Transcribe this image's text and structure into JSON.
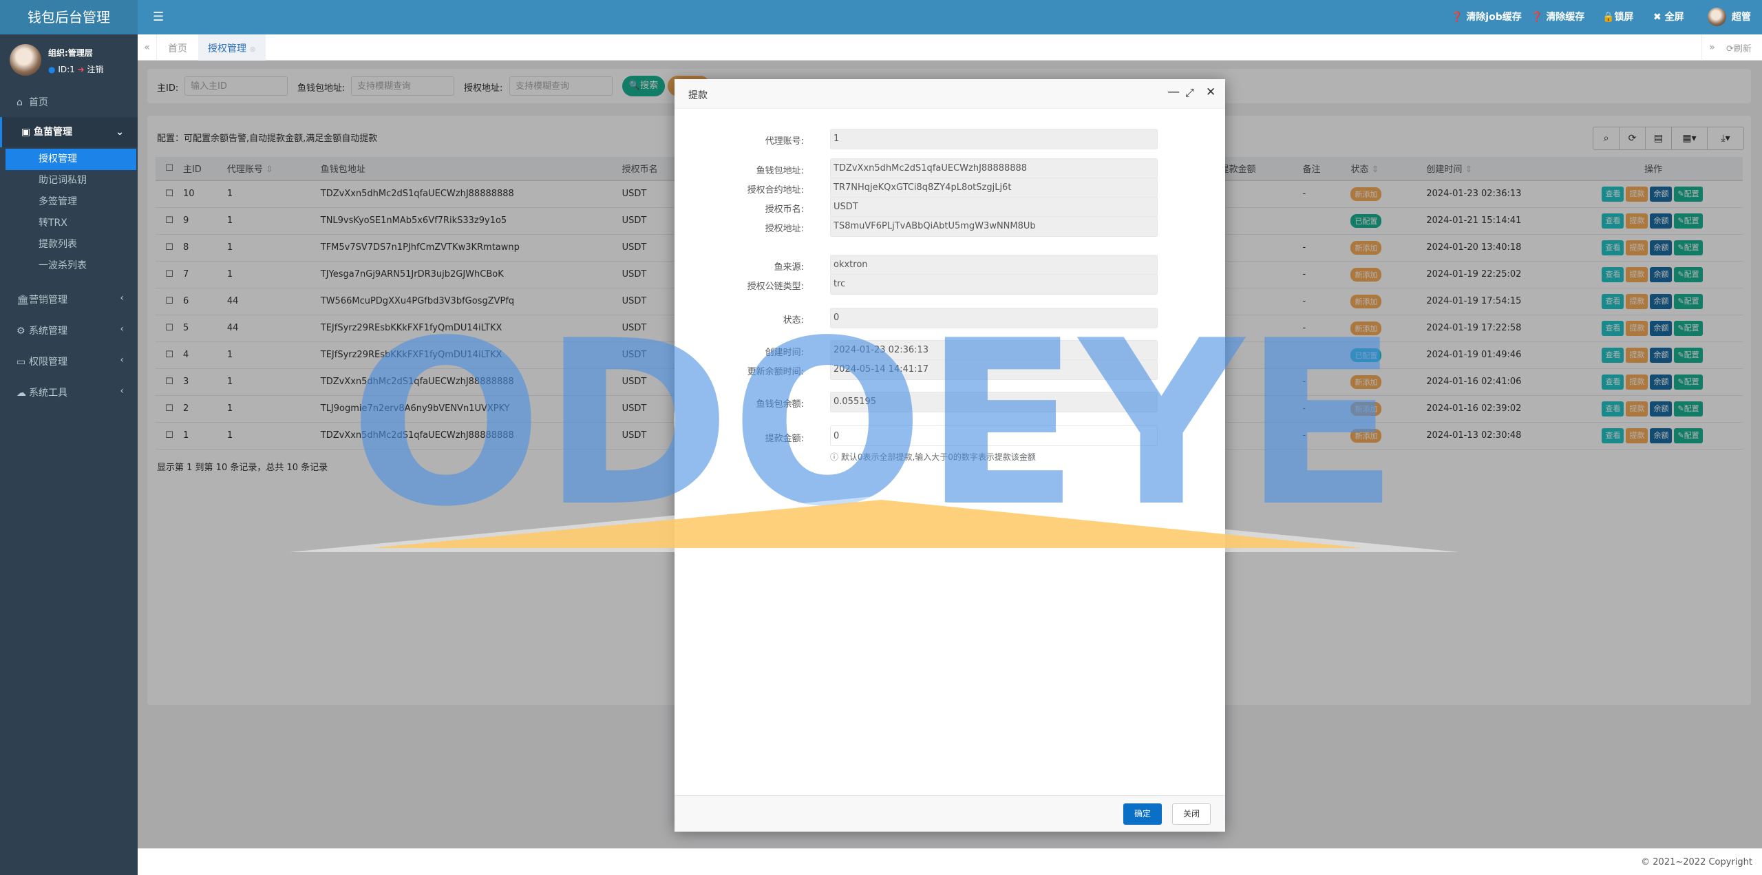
{
  "app": {
    "title": "钱包后台管理"
  },
  "topnav": {
    "clear_job_cache": "清除job缓存",
    "clear_cache": "清除缓存",
    "lock_screen": "锁屏",
    "fullscreen": "全屏",
    "user": "超管"
  },
  "user": {
    "org": "组织:管理层",
    "id": "ID:1",
    "logout": "注销"
  },
  "sidebar": {
    "home": "首页",
    "group": "鱼苗管理",
    "subitems": [
      "授权管理",
      "助记词私钥",
      "多签管理",
      "转TRX",
      "提款列表",
      "一波杀列表"
    ],
    "menus": [
      {
        "label": "营销管理",
        "icon": "bank-icon"
      },
      {
        "label": "系统管理",
        "icon": "gear-icon"
      },
      {
        "label": "权限管理",
        "icon": "id-card-icon"
      },
      {
        "label": "系统工具",
        "icon": "cloud-icon"
      }
    ]
  },
  "tabs": {
    "home": "首页",
    "active": "授权管理",
    "refresh": "刷新"
  },
  "search": {
    "id_label": "主ID:",
    "id_placeholder": "输入主ID",
    "wallet_label": "鱼钱包地址:",
    "wallet_placeholder": "支持模糊查询",
    "auth_label": "授权地址:",
    "auth_placeholder": "支持模糊查询",
    "search_btn": "搜索"
  },
  "config_note": "配置：可配置余额告警,自动提款金额,满足金额自动提款",
  "table": {
    "headers": [
      "主ID",
      "代理账号",
      "鱼钱包地址",
      "授权币名",
      "提款金额",
      "备注",
      "状态",
      "创建时间",
      "操作"
    ],
    "actions": [
      "查看",
      "提款",
      "余额",
      "配置"
    ],
    "rows": [
      {
        "id": "10",
        "agent": "1",
        "wallet": "TDZvXxn5dhMc2dS1qfaUECWzhJ88888888",
        "coin": "USDT",
        "note": "-",
        "status": "新添加",
        "status_color": "#f8ac59",
        "created": "2024-01-23 02:36:13"
      },
      {
        "id": "9",
        "agent": "1",
        "wallet": "TNL9vsKyoSE1nMAb5x6Vf7RikS33z9y1o5",
        "coin": "USDT",
        "note": "",
        "status": "已配置",
        "status_color": "#1ab394",
        "created": "2024-01-21 15:14:41"
      },
      {
        "id": "8",
        "agent": "1",
        "wallet": "TFM5v7SV7DS7n1PJhfCmZVTKw3KRmtawnp",
        "coin": "USDT",
        "note": "-",
        "status": "新添加",
        "status_color": "#f8ac59",
        "created": "2024-01-20 13:40:18"
      },
      {
        "id": "7",
        "agent": "1",
        "wallet": "TJYesga7nGj9ARN51JrDR3ujb2GJWhCBoK",
        "coin": "USDT",
        "note": "-",
        "status": "新添加",
        "status_color": "#f8ac59",
        "created": "2024-01-19 22:25:02"
      },
      {
        "id": "6",
        "agent": "44",
        "wallet": "TW566McuPDgXXu4PGfbd3V3bfGosgZVPfq",
        "coin": "USDT",
        "note": "-",
        "status": "新添加",
        "status_color": "#f8ac59",
        "created": "2024-01-19 17:54:15"
      },
      {
        "id": "5",
        "agent": "44",
        "wallet": "TEJfSyrz29REsbKKkFXF1fyQmDU14iLTKX",
        "coin": "USDT",
        "note": "-",
        "status": "新添加",
        "status_color": "#f8ac59",
        "created": "2024-01-19 17:22:58"
      },
      {
        "id": "4",
        "agent": "1",
        "wallet": "TEJfSyrz29REsbKKkFXF1fyQmDU14iLTKX",
        "coin": "USDT",
        "note": "",
        "status": "已配置",
        "status_color": "#23c6c8",
        "created": "2024-01-19 01:49:46"
      },
      {
        "id": "3",
        "agent": "1",
        "wallet": "TDZvXxn5dhMc2dS1qfaUECWzhJ88888888",
        "coin": "USDT",
        "note": "-",
        "status": "新添加",
        "status_color": "#f8ac59",
        "created": "2024-01-16 02:41:06"
      },
      {
        "id": "2",
        "agent": "1",
        "wallet": "TLJ9ogmie7n2erv8A6ny9bVENVn1UVXPKY",
        "coin": "USDT",
        "note": "-",
        "status": "新添加",
        "status_color": "#f8ac59",
        "created": "2024-01-16 02:39:02"
      },
      {
        "id": "1",
        "agent": "1",
        "wallet": "TDZvXxn5dhMc2dS1qfaUECWzhJ88888888",
        "coin": "USDT",
        "note": "-",
        "status": "新添加",
        "status_color": "#f8ac59",
        "created": "2024-01-13 02:30:48"
      }
    ],
    "pagination": "显示第 1 到第 10 条记录，总共 10 条记录"
  },
  "modal": {
    "title": "提款",
    "fields": [
      {
        "label": "代理账号:",
        "value": "1"
      },
      {
        "label": "鱼钱包地址:",
        "value": "TDZvXxn5dhMc2dS1qfaUECWzhJ88888888"
      },
      {
        "label": "授权合约地址:",
        "value": "TR7NHqjeKQxGTCi8q8ZY4pL8otSzgjLj6t"
      },
      {
        "label": "授权币名:",
        "value": "USDT"
      },
      {
        "label": "授权地址:",
        "value": "TS8muVF6PLjTvABbQiAbtU5mgW3wNNM8Ub"
      },
      {
        "label": "鱼来源:",
        "value": "okxtron"
      },
      {
        "label": "授权公链类型:",
        "value": "trc"
      },
      {
        "label": "状态:",
        "value": "0"
      },
      {
        "label": "创建时间:",
        "value": "2024-01-23 02:36:13"
      },
      {
        "label": "更新余额时间:",
        "value": "2024-05-14 14:41:17"
      },
      {
        "label": "鱼钱包余额:",
        "value": "0.055195"
      }
    ],
    "amount_label": "提款金额:",
    "amount_value": "0",
    "hint": "默认0表示全部提款,输入大于0的数字表示提款该金额",
    "confirm": "确定",
    "close": "关闭"
  },
  "footer": "© 2021~2022 Copyright",
  "watermark": "ODOEYE",
  "colors": {
    "header": "#3c8dbc",
    "sidebar": "#2f4050",
    "active": "#1c84e9",
    "primary": "#1ab394",
    "warning": "#f8ac59",
    "info": "#23c6c8",
    "dark": "#1c6ea4"
  }
}
